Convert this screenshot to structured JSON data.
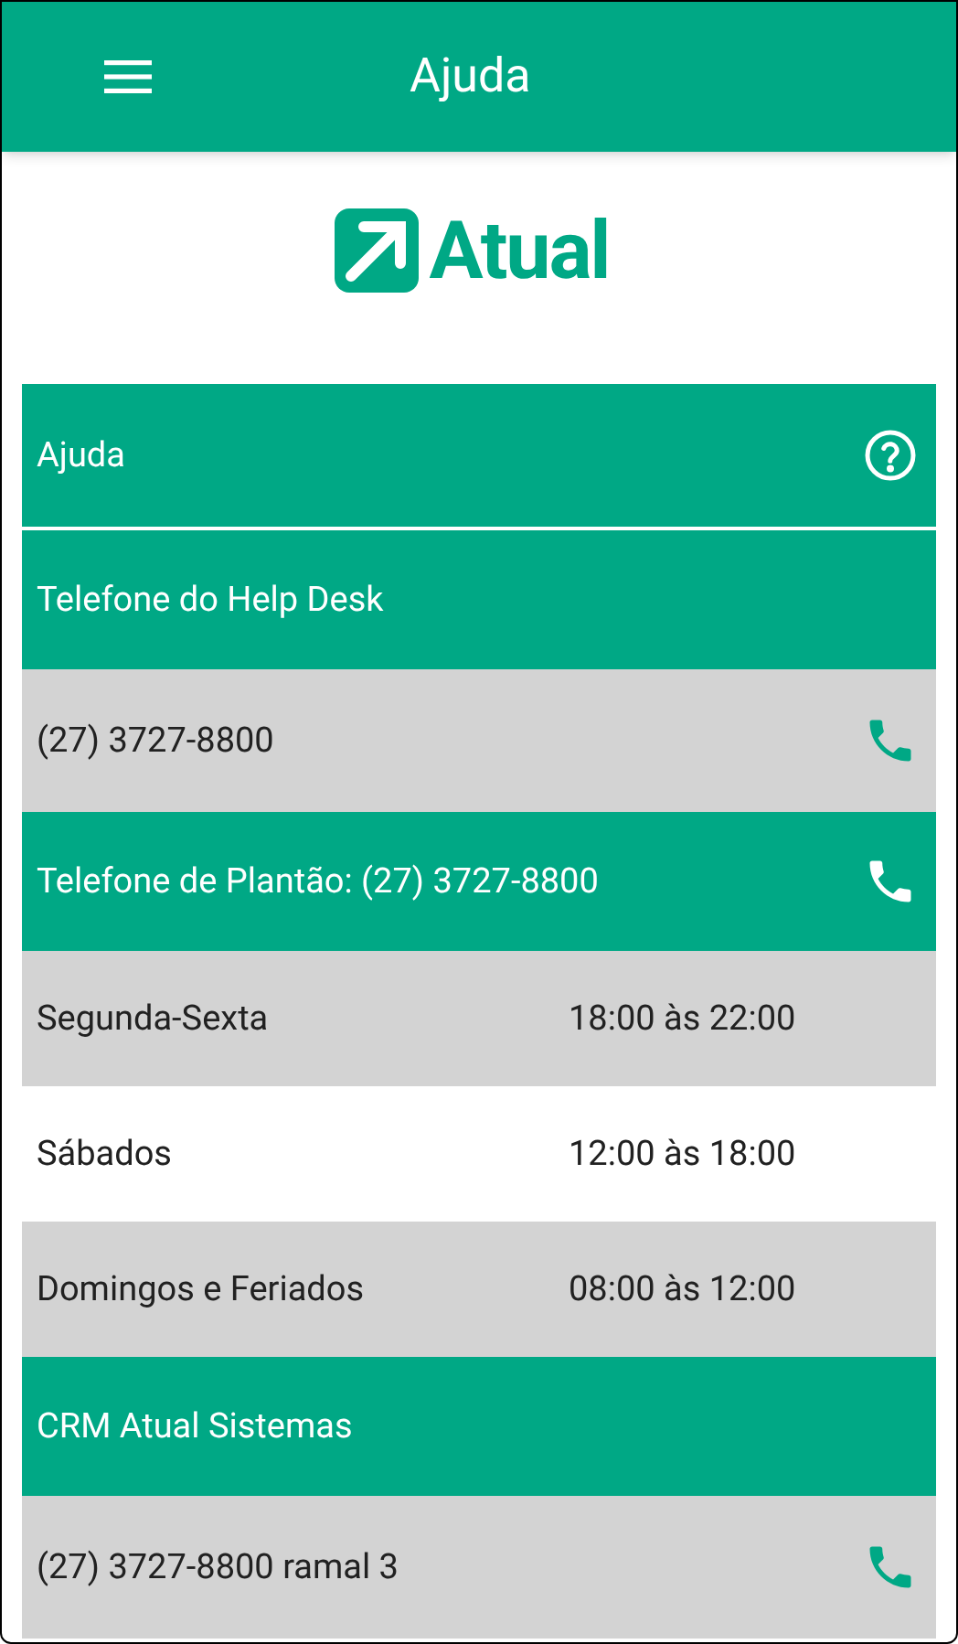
{
  "app_bar": {
    "title": "Ajuda"
  },
  "logo": {
    "text": "Atual"
  },
  "rows": [
    {
      "kind": "help_header",
      "text": "Ajuda"
    },
    {
      "kind": "header",
      "text": "Telefone do Help Desk"
    },
    {
      "kind": "phone",
      "text": "(27) 3727-8800"
    },
    {
      "kind": "call_header",
      "text": "Telefone de Plantão: (27) 3727-8800"
    },
    {
      "kind": "hours",
      "text": "Segunda-Sexta",
      "time": "18:00 às 22:00",
      "shaded": true
    },
    {
      "kind": "hours",
      "text": "Sábados",
      "time": "12:00 às 18:00",
      "shaded": false
    },
    {
      "kind": "hours",
      "text": "Domingos e Feriados",
      "time": "08:00 às 12:00",
      "shaded": true
    },
    {
      "kind": "header",
      "text": "CRM Atual Sistemas"
    },
    {
      "kind": "phone",
      "text": "(27) 3727-8800 ramal 3"
    }
  ]
}
